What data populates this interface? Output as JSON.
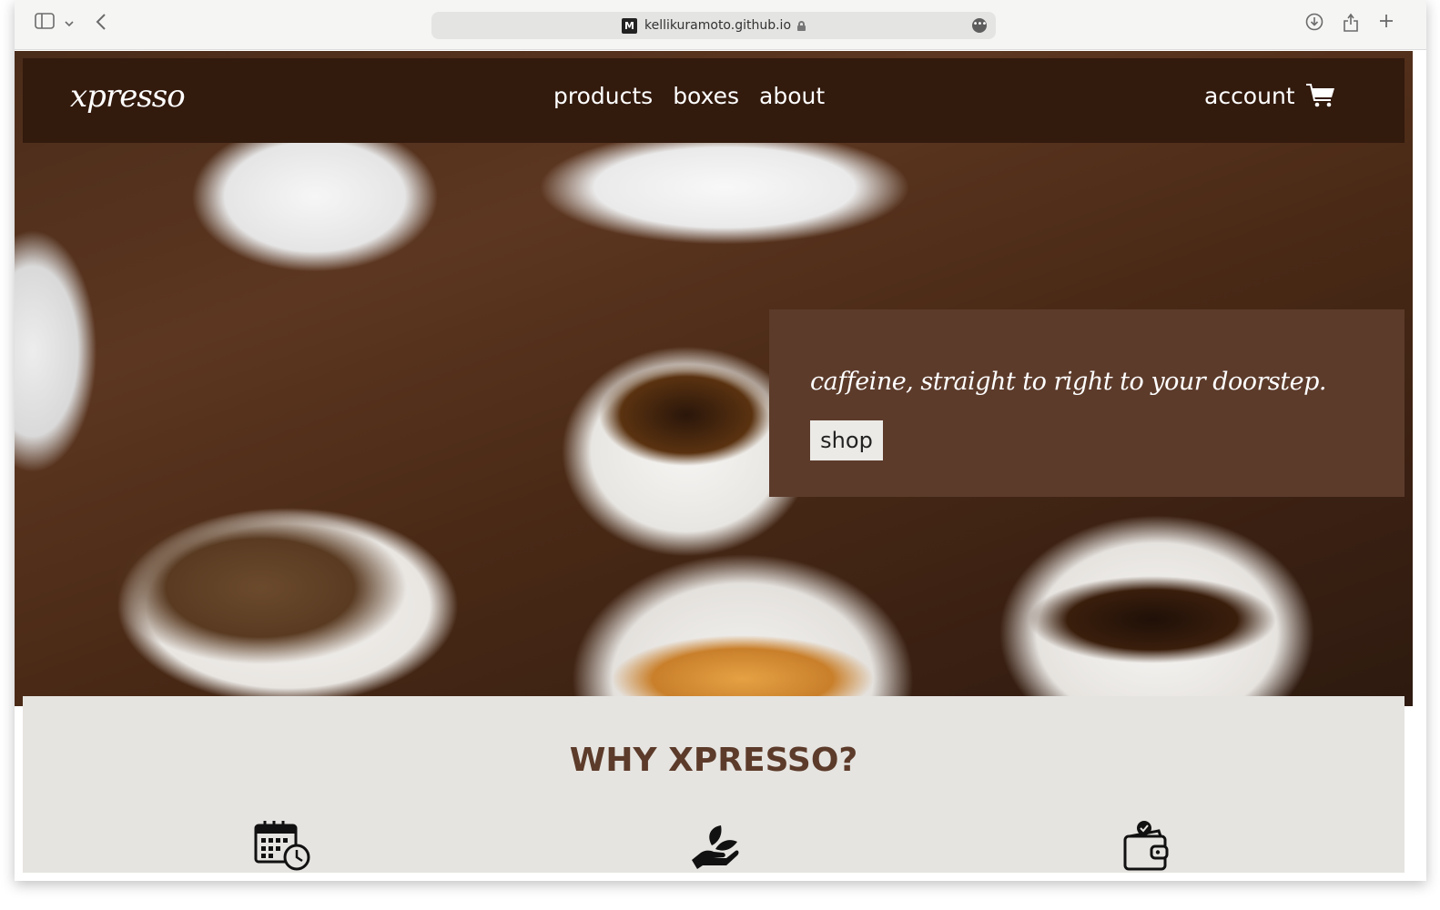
{
  "browser": {
    "url": "kellikuramoto.github.io",
    "favicon_letter": "M"
  },
  "nav": {
    "logo": "xpresso",
    "links": [
      "products",
      "boxes",
      "about"
    ],
    "account": "account",
    "cart_icon": "cart-icon"
  },
  "hero": {
    "tagline": "caffeine, straight to right to your doorstep.",
    "shop_label": "shop"
  },
  "why": {
    "title": "WHY XPRESSO?",
    "icons": [
      "calendar-clock-icon",
      "hand-plant-icon",
      "wallet-check-icon"
    ]
  },
  "colors": {
    "nav_bg": "#321a0d",
    "promo_bg": "#5c3b2b",
    "section_bg": "#e6e4e0",
    "accent_text": "#5c3b2b"
  }
}
